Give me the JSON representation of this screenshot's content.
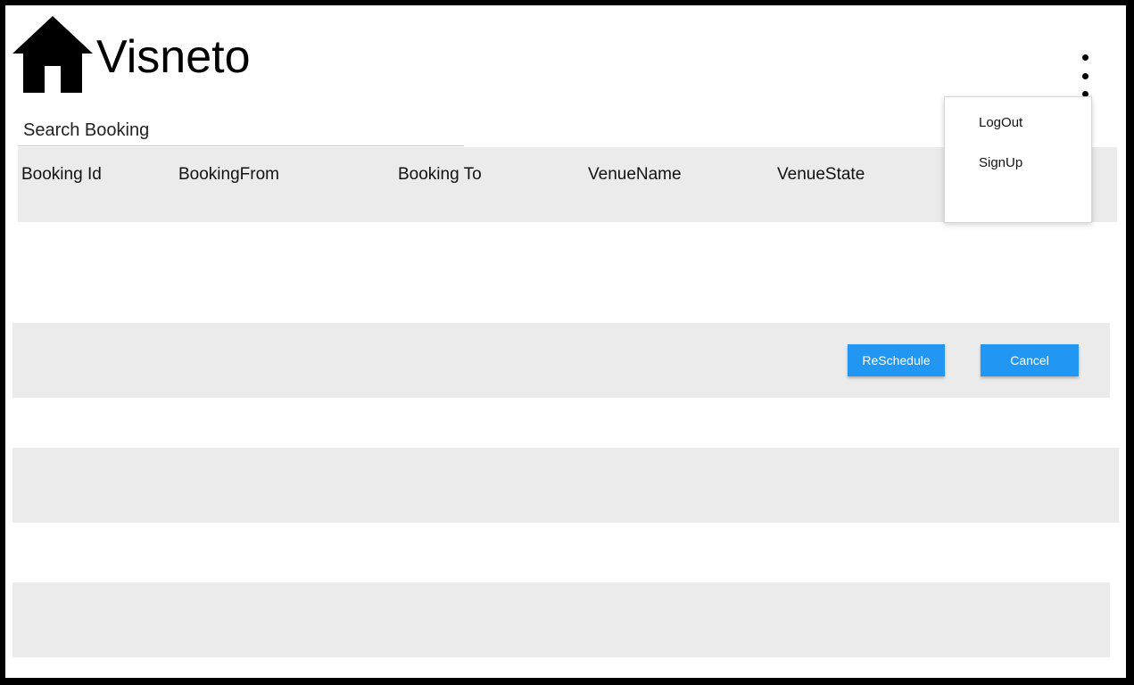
{
  "header": {
    "app_title": "Visneto",
    "logo_icon": "home-icon",
    "menu_icon": "kebab-menu-icon"
  },
  "search": {
    "placeholder": "Search Booking",
    "value": ""
  },
  "table": {
    "columns": [
      "Booking Id",
      "BookingFrom",
      "Booking To",
      "VenueName",
      "VenueState"
    ]
  },
  "actions": {
    "reschedule_label": "ReSchedule",
    "cancel_label": "Cancel"
  },
  "dropdown_menu": {
    "items": [
      {
        "label": "LogOut"
      },
      {
        "label": "SignUp"
      }
    ]
  },
  "colors": {
    "accent": "#2196f3",
    "row_band": "#ebebeb",
    "frame_border": "#000000"
  }
}
